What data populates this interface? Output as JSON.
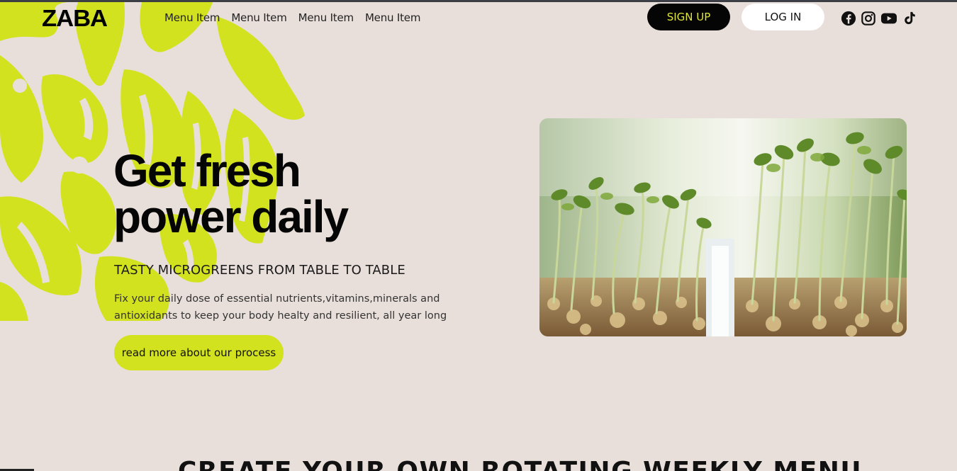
{
  "brand": {
    "logo": "ZABA"
  },
  "nav": {
    "items": [
      "Menu Item",
      "Menu Item",
      "Menu Item",
      "Menu Item"
    ]
  },
  "auth": {
    "signup_label": "SIGN UP",
    "login_label": "LOG IN"
  },
  "socials": [
    "facebook-icon",
    "instagram-icon",
    "youtube-icon",
    "tiktok-icon"
  ],
  "hero": {
    "title_line1": "Get fresh",
    "title_line2": "power daily",
    "subtitle": "TASTY MICROGREENS FROM TABLE TO TABLE",
    "desc_line1": "Fix your daily dose of essential nutrients,vitamins,minerals and",
    "desc_line2": "antioxidants to keep your body healty and resilient, all year long",
    "cta_label": "read more about our process"
  },
  "next_section": {
    "title": "CREATE YOUR OWN ROTATING WEEKLY MENU"
  },
  "colors": {
    "background": "#e8dfda",
    "accent": "#d3e21f",
    "dark": "#050505"
  }
}
